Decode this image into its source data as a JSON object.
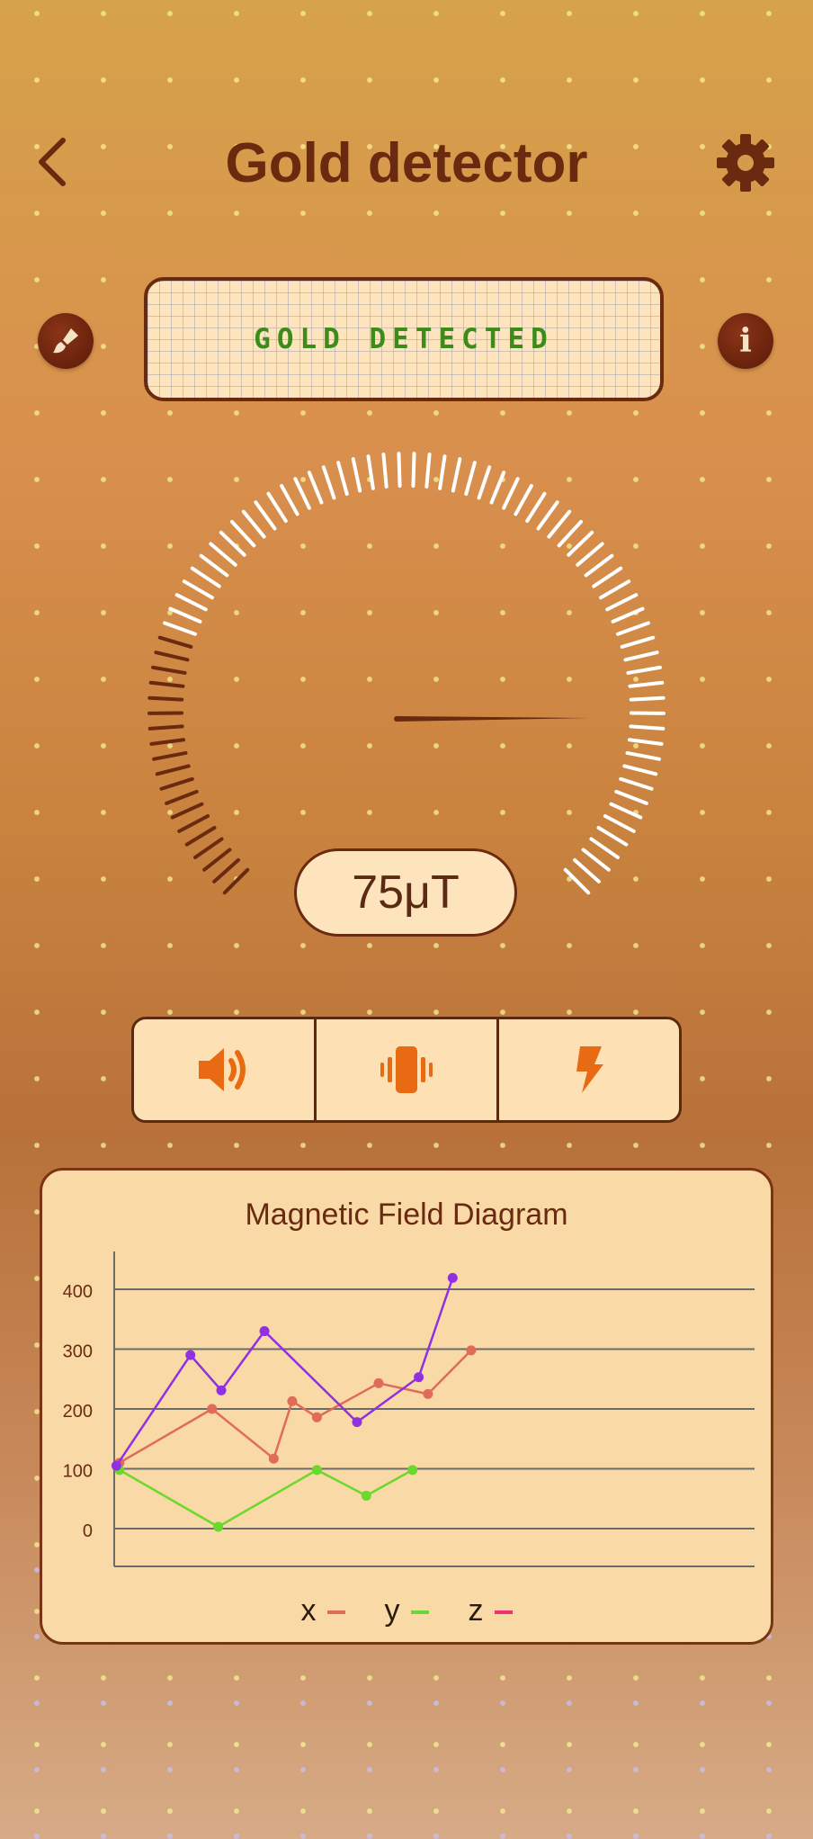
{
  "app": {
    "title": "Gold detector"
  },
  "header": {
    "back_icon": "chevron-left-icon",
    "settings_icon": "gear-icon"
  },
  "actions": {
    "left_icon": "brush-icon",
    "right_icon": "info-icon",
    "info_glyph": "i"
  },
  "status": {
    "text": "GOLD DETECTED",
    "color": "#3c8c1c"
  },
  "gauge": {
    "value_label": "75μT",
    "value": 75
  },
  "toggles": [
    {
      "icon": "speaker-icon"
    },
    {
      "icon": "vibration-icon"
    },
    {
      "icon": "flash-icon"
    }
  ],
  "colors": {
    "brand_dark": "#6a2a10",
    "panel_bg": "#fde4bd",
    "series_x": "#e06b5a",
    "series_y": "#6ad82c",
    "series_z": "#9030e0"
  },
  "chart": {
    "title": "Magnetic Field Diagram"
  },
  "chart_data": {
    "type": "line",
    "title": "Magnetic Field Diagram",
    "xlabel": "",
    "ylabel": "",
    "ylim": [
      -60,
      460
    ],
    "yticks": [
      0,
      100,
      200,
      300,
      400
    ],
    "grid": true,
    "legend_position": "bottom",
    "legend": [
      {
        "label": "x",
        "color": "#e06b5a"
      },
      {
        "label": "y",
        "color": "#6ad82c"
      },
      {
        "label": "z",
        "color": "#f0307a"
      }
    ],
    "series": [
      {
        "name": "x",
        "color": "#e06b5a",
        "points": [
          [
            0.2,
            110
          ],
          [
            3.2,
            200
          ],
          [
            5.2,
            117
          ],
          [
            5.8,
            213
          ],
          [
            6.6,
            186
          ],
          [
            8.6,
            243
          ],
          [
            10.2,
            225
          ],
          [
            11.6,
            298
          ]
        ]
      },
      {
        "name": "y",
        "color": "#6ad82c",
        "points": [
          [
            0.2,
            98
          ],
          [
            3.4,
            3
          ],
          [
            6.6,
            98
          ],
          [
            8.2,
            55
          ],
          [
            9.7,
            98
          ]
        ]
      },
      {
        "color": "#9030e0",
        "points": [
          [
            0.1,
            105
          ],
          [
            2.5,
            290
          ],
          [
            3.5,
            231
          ],
          [
            4.9,
            330
          ],
          [
            7.9,
            178
          ],
          [
            9.9,
            253
          ],
          [
            11.0,
            419
          ]
        ]
      }
    ]
  }
}
